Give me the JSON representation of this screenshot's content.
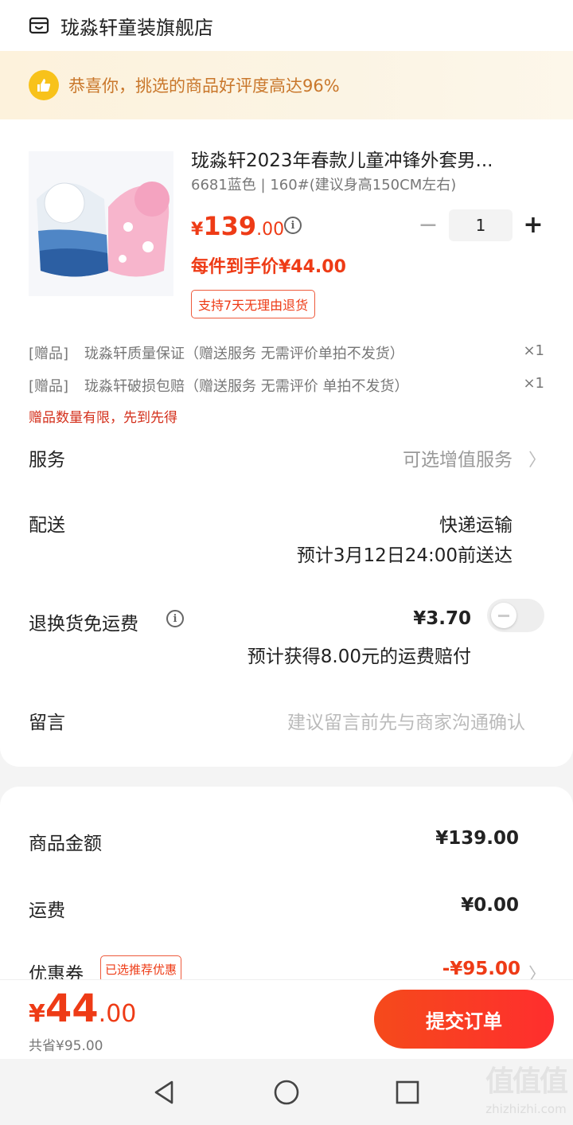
{
  "header": {
    "shop_name": "珑淼轩童装旗舰店"
  },
  "banner": {
    "text": "恭喜你，挑选的商品好评度高达96%"
  },
  "product": {
    "title": "珑淼轩2023年春款儿童冲锋外套男...",
    "spec": "6681蓝色 | 160#(建议身高150CM左右)",
    "price_symbol": "¥",
    "price_int": "139",
    "price_dec": ".00",
    "unit_price": "每件到手价¥44.00",
    "return_policy": "支持7天无理由退货",
    "quantity": "1",
    "minus_symbol": "−",
    "plus_symbol": "+"
  },
  "gifts": [
    {
      "tag": "[赠品]",
      "name": "珑淼轩质量保证（赠送服务 无需评价单拍不发货）",
      "qty": "×1"
    },
    {
      "tag": "[赠品]",
      "name": "珑淼轩破损包赔（赠送服务 无需评价 单拍不发货）",
      "qty": "×1"
    }
  ],
  "gift_note": "赠品数量有限，先到先得",
  "service": {
    "label": "服务",
    "value": "可选增值服务"
  },
  "delivery": {
    "label": "配送",
    "method": "快递运输",
    "eta": "预计3月12日24:00前送达"
  },
  "return_shipping": {
    "label": "退换货免运费",
    "price": "¥3.70",
    "note": "预计获得8.00元的运费赔付",
    "enabled": false
  },
  "message": {
    "label": "留言",
    "placeholder": "建议留言前先与商家沟通确认"
  },
  "summary": {
    "goods_label": "商品金额",
    "goods_value": "¥139.00",
    "shipping_label": "运费",
    "shipping_value": "¥0.00",
    "coupon_label": "优惠券",
    "coupon_badge": "已选推荐优惠",
    "coupon_value": "-¥95.00"
  },
  "bottom": {
    "total_symbol": "¥",
    "total_int": "44",
    "total_dec": ".00",
    "saved": "共省¥95.00",
    "submit": "提交订单"
  },
  "watermark": {
    "big": "值值值",
    "small": "zhizhizhi.com"
  },
  "colors": {
    "accent": "#ee3b16",
    "banner_text": "#c9772b",
    "thumb": "#f8c21a"
  }
}
